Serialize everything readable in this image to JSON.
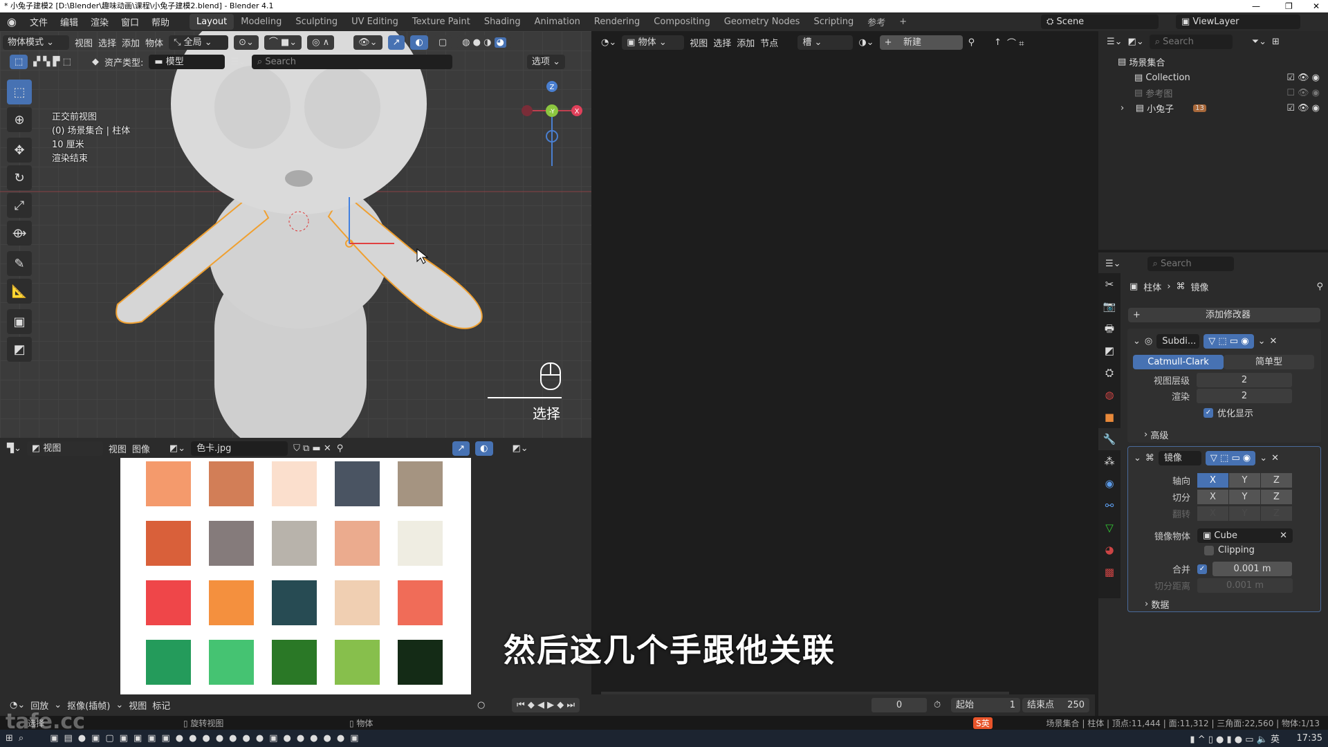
{
  "window": {
    "title": "* 小兔子建模2 [D:\\Blender\\趣味动画\\课程\\小兔子建模2.blend] - Blender 4.1"
  },
  "menu": [
    "文件",
    "编辑",
    "渲染",
    "窗口",
    "帮助"
  ],
  "workspaces": [
    "Layout",
    "Modeling",
    "Sculpting",
    "UV Editing",
    "Texture Paint",
    "Shading",
    "Animation",
    "Rendering",
    "Compositing",
    "Geometry Nodes",
    "Scripting",
    "参考"
  ],
  "active_workspace": "Layout",
  "scene": "Scene",
  "view_layer": "ViewLayer",
  "viewport": {
    "mode": "物体模式",
    "menus": [
      "视图",
      "选择",
      "添加",
      "物体"
    ],
    "transform": "全局",
    "asset_type_label": "资产类型:",
    "asset_type": "模型",
    "search_placeholder": "Search",
    "options": "选项",
    "overlay": [
      "正交前视图",
      "(0) 场景集合 | 柱体",
      "10 厘米",
      "渲染结束"
    ],
    "mouse_hint": "选择"
  },
  "shader_editor": {
    "type": "物体",
    "menus": [
      "视图",
      "选择",
      "添加",
      "节点"
    ],
    "slot": "槽",
    "new": "新建"
  },
  "image_editor": {
    "mode": "视图",
    "menus": [
      "视图",
      "图像"
    ],
    "image": "色卡.jpg",
    "palette": [
      [
        "#f49a6c",
        "#d27e57",
        "#fbdfcd",
        "#4a5462",
        "#a59481"
      ],
      [
        "#d9603a",
        "#857b7b",
        "#b8b3ab",
        "#ebab8e",
        "#efede2"
      ],
      [
        "#ef4649",
        "#f4903e",
        "#274b53",
        "#f0cfb2",
        "#f06c58"
      ],
      [
        "#249b5b",
        "#45c372",
        "#2a7826",
        "#87bf4c",
        "#142b16"
      ]
    ]
  },
  "outliner": {
    "search_placeholder": "Search",
    "root": "场景集合",
    "items": [
      {
        "name": "Collection",
        "dim": false
      },
      {
        "name": "参考图",
        "dim": true
      },
      {
        "name": "小兔子",
        "badge": "13",
        "dim": false
      }
    ]
  },
  "properties": {
    "search_placeholder": "Search",
    "breadcrumb": [
      "柱体",
      "镜像"
    ],
    "add_modifier": "添加修改器",
    "subdiv": {
      "name": "Subdi...",
      "types": [
        "Catmull-Clark",
        "简单型"
      ],
      "viewport_label": "视图层级",
      "viewport_levels": "2",
      "render_label": "渲染",
      "render_levels": "2",
      "optimal": "优化显示",
      "advanced": "高级"
    },
    "mirror": {
      "name": "镜像",
      "axis_label": "轴向",
      "bisect_label": "切分",
      "flip_label": "翻转",
      "axes": [
        "X",
        "Y",
        "Z"
      ],
      "axis_active": "X",
      "mirror_object_label": "镜像物体",
      "mirror_object": "Cube",
      "clipping": "Clipping",
      "merge_label": "合并",
      "merge": "0.001 m",
      "bisect_distance_label": "切分距离",
      "bisect_distance": "0.001 m",
      "data": "数据"
    }
  },
  "timeline": {
    "menus": [
      "回放",
      "抠像(插帧)",
      "视图",
      "标记"
    ],
    "frame": "0",
    "start_label": "起始",
    "start": "1",
    "end_label": "结束点",
    "end": "250"
  },
  "statusbar": {
    "hints": [
      "选择",
      "旋转视图",
      "物体"
    ],
    "stats": "场景集合 | 柱体 | 顶点:11,444 | 面:11,312 | 三角面:22,560 | 物体:1/13"
  },
  "watermark": "tafe.cc",
  "taskbar": {
    "ime": "英",
    "time": "17:35"
  },
  "subtitle": "然后这几个手跟他关联"
}
